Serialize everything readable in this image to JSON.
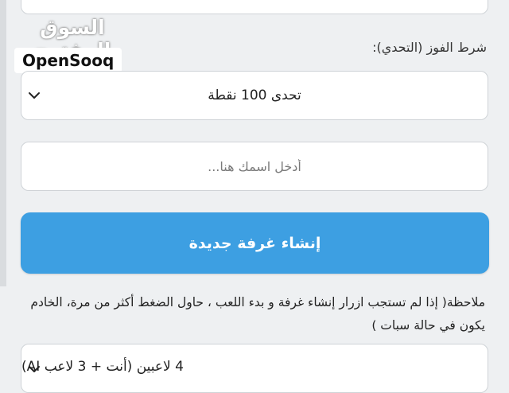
{
  "watermark": {
    "arabic": "السوق المفتوح",
    "brand": "OpenSooq"
  },
  "win_condition": {
    "label": "شرط الفوز (التحدي):",
    "selected": "تحدى 100 نقطة"
  },
  "name_input": {
    "placeholder": "أدخل اسمك هنا...",
    "value": ""
  },
  "create_button": {
    "label": "إنشاء غرفة جديدة"
  },
  "note": {
    "text": "ملاحظة( إذا لم تستجب ازرار إنشاء غرفة و بدء اللعب ، حاول الضغط أكثر من مرة، الخادم يكون في حالة سبات )"
  },
  "players_select": {
    "selected": "4 لاعبين (أنت + 3 لاعب AI)"
  }
}
